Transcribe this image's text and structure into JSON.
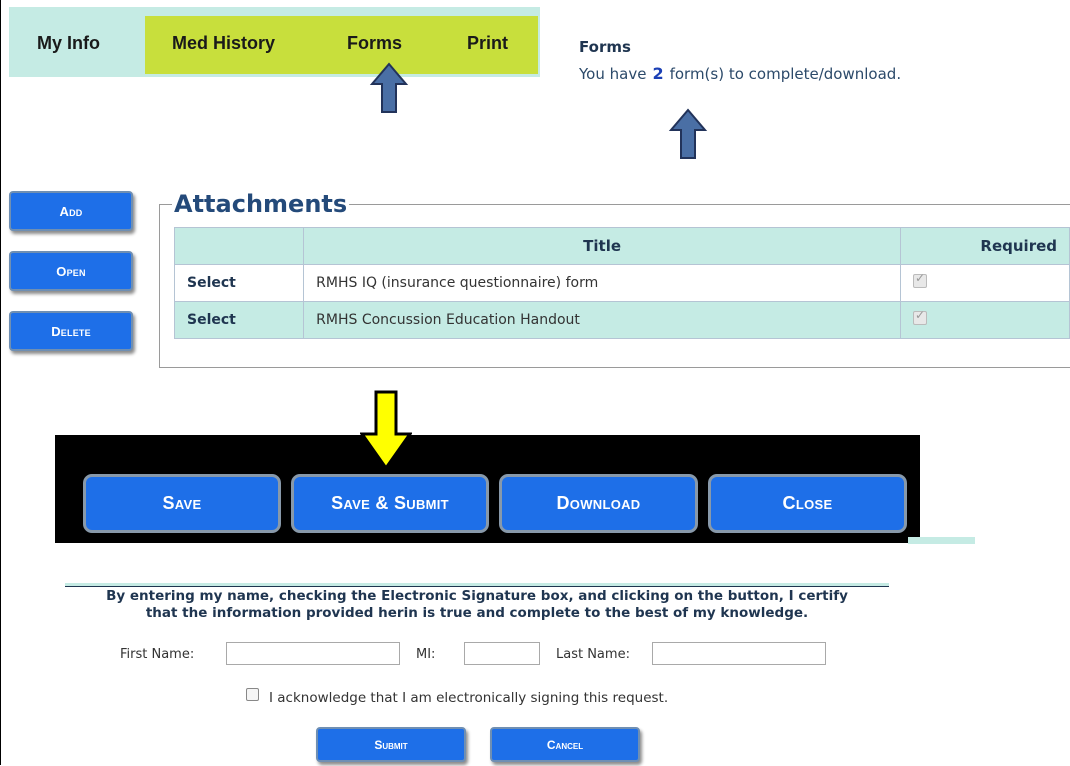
{
  "nav": {
    "items": [
      "My Info",
      "Med History",
      "Forms",
      "Print"
    ]
  },
  "forms_info": {
    "title": "Forms",
    "prefix": "You have",
    "count": "2",
    "suffix": "form(s) to complete/download."
  },
  "side_buttons": {
    "add": "Add",
    "open": "Open",
    "delete": "Delete"
  },
  "attachments": {
    "legend": "Attachments",
    "columns": [
      "",
      "Title",
      "Required"
    ],
    "rows": [
      {
        "action": "Select",
        "title": "RMHS IQ (insurance questionnaire) form",
        "required": true
      },
      {
        "action": "Select",
        "title": "RMHS Concussion Education Handout",
        "required": true
      }
    ]
  },
  "toolbar": {
    "save": "Save",
    "save_submit": "Save & Submit",
    "download": "Download",
    "close": "Close"
  },
  "signature": {
    "certify_line1": "By entering my name, checking the Electronic Signature box, and clicking on the button, I certify",
    "certify_line2": "that the information provided herin is true and complete to the best of my knowledge.",
    "first_name_label": "First Name:",
    "mi_label": "MI:",
    "last_name_label": "Last Name:",
    "first_name_value": "",
    "mi_value": "",
    "last_name_value": "",
    "acknowledge": "I acknowledge that I am electronically signing this request.",
    "submit": "Submit",
    "cancel": "Cancel"
  },
  "colors": {
    "nav_bg": "#c5ebe4",
    "nav_active": "#c8df3c",
    "button_blue": "#1e6fe8",
    "heading_blue": "#244a7a",
    "arrow_blue": "#4a6fa5",
    "callout_yellow": "#ffff00"
  }
}
